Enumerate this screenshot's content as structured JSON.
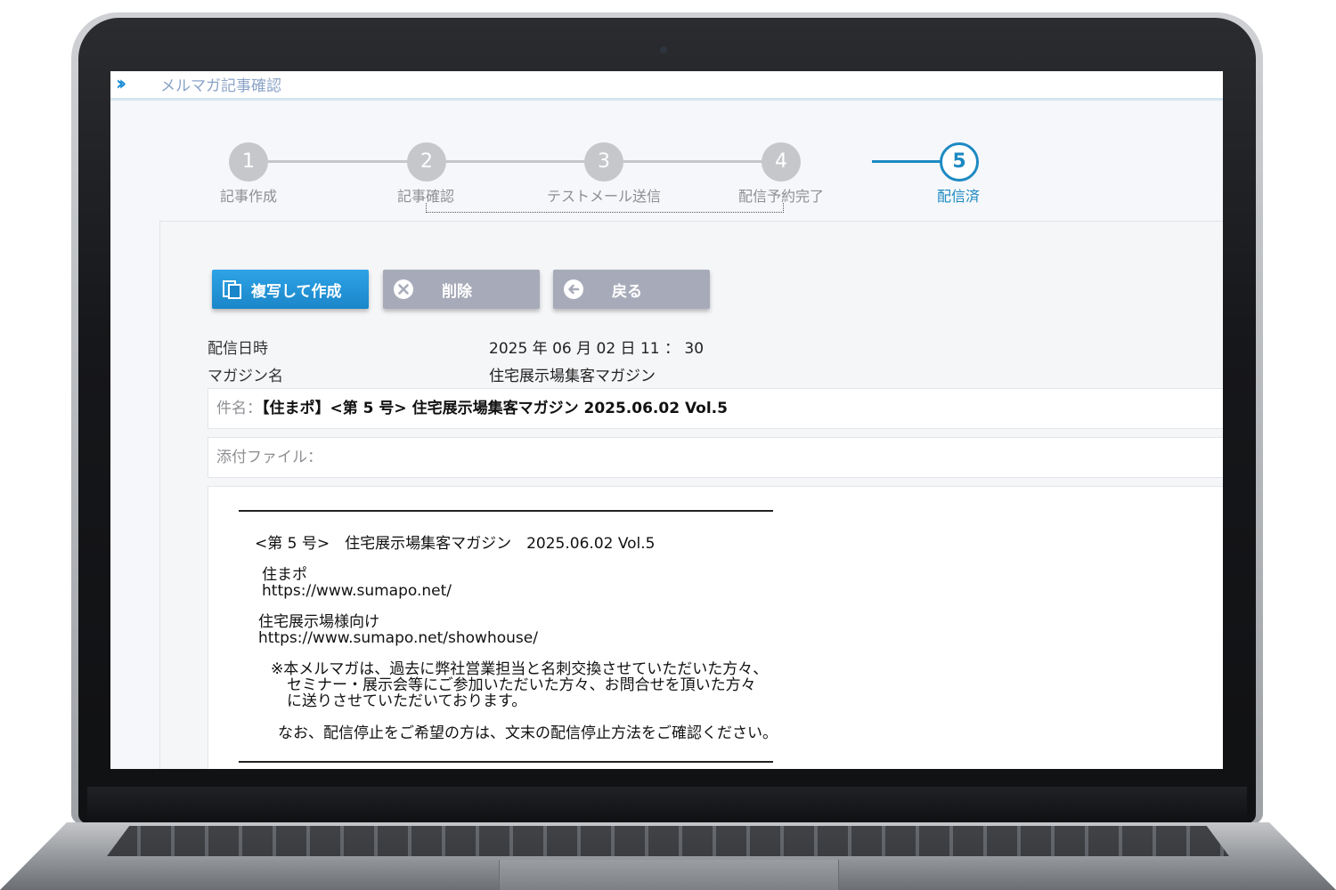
{
  "header": {
    "title": "メルマガ記事確認"
  },
  "steps": [
    {
      "num": "1",
      "label": "記事作成"
    },
    {
      "num": "2",
      "label": "記事確認"
    },
    {
      "num": "3",
      "label": "テストメール送信"
    },
    {
      "num": "4",
      "label": "配信予約完了"
    },
    {
      "num": "5",
      "label": "配信済"
    }
  ],
  "active_step": 5,
  "buttons": {
    "copy": "複写して作成",
    "delete": "削除",
    "back": "戻る"
  },
  "meta": {
    "date_label": "配信日時",
    "date_value": "2025 年 06 月 02 日 11 ： 30",
    "magazine_label": "マガジン名",
    "magazine_value": "住宅展示場集客マガジン"
  },
  "subject": {
    "label": "件名：",
    "value": "【住まポ】<第 5 号> 住宅展示場集客マガジン 2025.06.02 Vol.5"
  },
  "attachment": {
    "label": "添付ファイル："
  },
  "mail_body": {
    "issue_line": "<第 5 号>　住宅展示場集客マガジン　2025.06.02 Vol.5",
    "brand": "住まポ",
    "brand_url": "https://www.sumapo.net/",
    "target": "住宅展示場様向け",
    "target_url": "https://www.sumapo.net/showhouse/",
    "note_1": "※本メルマガは、過去に弊社営業担当と名刺交換させていただいた方々、",
    "note_2": "セミナー・展示会等にご参加いただいた方々、お問合せを頂いた方々",
    "note_3": "に送りさせていただいております。",
    "note_4": "なお、配信停止をご希望の方は、文末の配信停止方法をご確認ください。"
  },
  "colors": {
    "accent": "#1d8ac2",
    "copy_button": "#1a86c9",
    "secondary_button": "#a7abb9",
    "inactive_step": "#c5c7cb"
  }
}
